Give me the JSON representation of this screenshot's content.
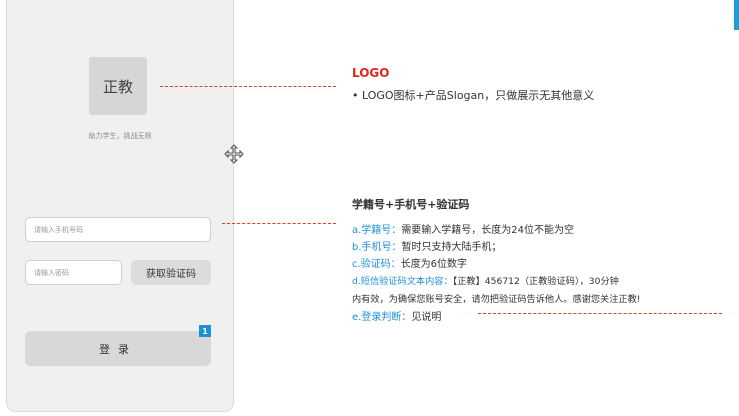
{
  "phone": {
    "logo_text": "正教",
    "slogan": "助力学生，挑战无限",
    "phone_placeholder": "请输入手机号码",
    "code_placeholder": "请输入密码",
    "get_code_label": "获取验证码",
    "login_label": "登录",
    "badge": "1"
  },
  "annotations": {
    "logo_title": "LOGO",
    "logo_desc": "• LOGO图标+产品Slogan，只做展示无其他意义",
    "form_title": "学籍号+手机号+验证码",
    "items": [
      {
        "key": "a.学籍号：",
        "text": "需要输入学籍号，长度为24位不能为空"
      },
      {
        "key": "b.手机号：",
        "text": "暂时只支持大陆手机；"
      },
      {
        "key": "c.验证码：",
        "text": "长度为6位数字"
      },
      {
        "key": "d.短信验证码文本内容：",
        "text": "【正教】456712（正教验证码），30分钟"
      }
    ],
    "sms_continued": "内有效，为确保您账号安全，请勿把验证码告诉他人。感谢您关注正教!",
    "login_item": {
      "key": "e.登录判断：",
      "text": "见说明"
    }
  },
  "colors": {
    "accent_blue": "#1f8fd9",
    "annotation_red": "#e0281c",
    "badge_blue": "#1e90d6"
  },
  "icons": {
    "move": "move-cursor-icon"
  }
}
